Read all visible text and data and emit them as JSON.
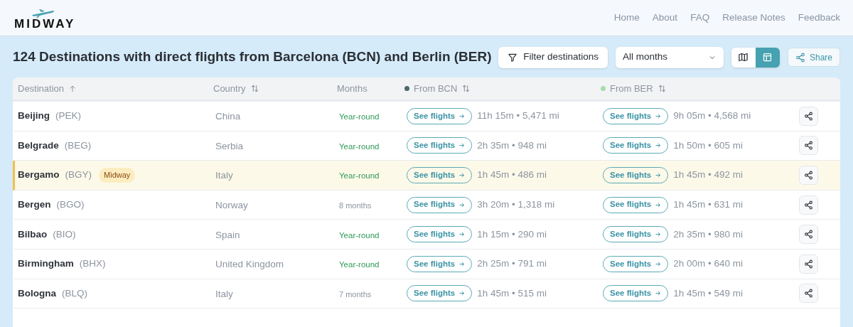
{
  "logo": {
    "text": "MIDWAY"
  },
  "nav": [
    "Home",
    "About",
    "FAQ",
    "Release Notes",
    "Feedback"
  ],
  "title": "124 Destinations with direct flights from Barcelona (BCN) and Berlin (BER)",
  "toolbar": {
    "filter_button": "Filter destinations",
    "months_select": "All months",
    "views": [
      {
        "kind": "map",
        "selected": false
      },
      {
        "kind": "table",
        "selected": true
      }
    ],
    "share_button": "Share"
  },
  "table": {
    "columns": [
      {
        "label": "Destination",
        "sort_ascending": true
      },
      {
        "label": "Country",
        "sortable": true
      },
      {
        "label": "Months",
        "sortable": false
      },
      {
        "label": "From BCN",
        "sortable": true,
        "color": "#4b6a6a"
      },
      {
        "label": "From BER",
        "sortable": true,
        "color": "#a8dcab"
      }
    ],
    "rows": [
      {
        "city": "Beijing",
        "code": "(PEK)",
        "country": "China",
        "months": "Year-round",
        "year_round": true,
        "bcn": {
          "button": "See flights",
          "info": "11h 15m • 5,471 mi"
        },
        "ber": {
          "button": "See flights",
          "info": "9h 05m • 4,568 mi"
        },
        "highlighted": false
      },
      {
        "city": "Belgrade",
        "code": "(BEG)",
        "country": "Serbia",
        "months": "Year-round",
        "year_round": true,
        "bcn": {
          "button": "See flights",
          "info": "2h 35m • 948 mi"
        },
        "ber": {
          "button": "See flights",
          "info": "1h 50m • 605 mi"
        },
        "highlighted": false
      },
      {
        "city": "Bergamo",
        "code": "(BGY)",
        "badge": "Midway",
        "country": "Italy",
        "months": "Year-round",
        "year_round": true,
        "bcn": {
          "button": "See flights",
          "info": "1h 45m • 486 mi"
        },
        "ber": {
          "button": "See flights",
          "info": "1h 45m • 492 mi"
        },
        "highlighted": true
      },
      {
        "city": "Bergen",
        "code": "(BGO)",
        "country": "Norway",
        "months": "8 months",
        "year_round": false,
        "bcn": {
          "button": "See flights",
          "info": "3h 20m • 1,318 mi"
        },
        "ber": {
          "button": "See flights",
          "info": "1h 45m • 631 mi"
        },
        "highlighted": false
      },
      {
        "city": "Bilbao",
        "code": "(BIO)",
        "country": "Spain",
        "months": "Year-round",
        "year_round": true,
        "bcn": {
          "button": "See flights",
          "info": "1h 15m • 290 mi"
        },
        "ber": {
          "button": "See flights",
          "info": "2h 35m • 980 mi"
        },
        "highlighted": false
      },
      {
        "city": "Birmingham",
        "code": "(BHX)",
        "country": "United Kingdom",
        "months": "Year-round",
        "year_round": true,
        "bcn": {
          "button": "See flights",
          "info": "2h 25m • 791 mi"
        },
        "ber": {
          "button": "See flights",
          "info": "2h 00m • 640 mi"
        },
        "highlighted": false
      },
      {
        "city": "Bologna",
        "code": "(BLQ)",
        "country": "Italy",
        "months": "7 months",
        "year_round": false,
        "bcn": {
          "button": "See flights",
          "info": "1h 45m • 515 mi"
        },
        "ber": {
          "button": "See flights",
          "info": "1h 45m • 549 mi"
        },
        "highlighted": false
      }
    ]
  }
}
